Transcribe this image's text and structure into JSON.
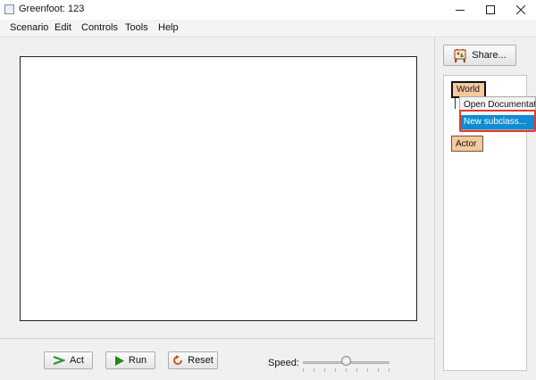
{
  "window": {
    "title": "Greenfoot: 123",
    "controls": [
      "minimize-icon",
      "maximize-icon",
      "close-icon"
    ]
  },
  "menubar": {
    "items": [
      "Scenario",
      "Edit",
      "Controls",
      "Tools",
      "Help"
    ]
  },
  "controls": {
    "act_label": "Act",
    "run_label": "Run",
    "reset_label": "Reset",
    "speed_label": "Speed:",
    "speed_value_fraction": 0.5
  },
  "class_panel": {
    "share_label": "Share...",
    "world_class": "World",
    "actor_class": "Actor"
  },
  "context_menu": {
    "items": [
      "Open Documentation",
      "New subclass..."
    ],
    "selected": "New subclass..."
  },
  "colors": {
    "class_fill": "#f5c99d",
    "menu_selected": "#0e8dd4",
    "highlight": "#e23b2e",
    "act_icon": "#2a8f2a",
    "run_icon": "#1c8a1c",
    "reset_icon": "#c55a11"
  }
}
